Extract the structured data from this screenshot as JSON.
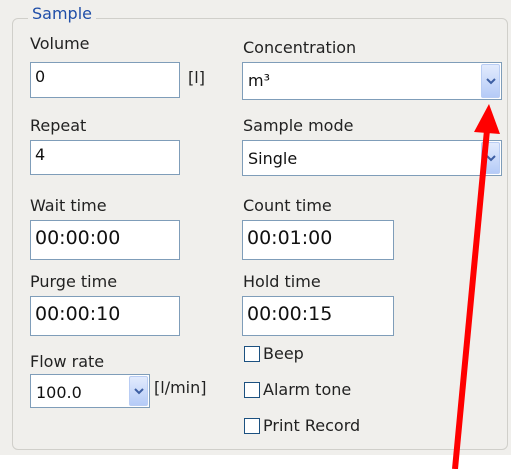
{
  "group": {
    "title": "Sample"
  },
  "volume": {
    "label": "Volume",
    "value": "0",
    "unit": "[l]"
  },
  "concentration": {
    "label": "Concentration",
    "selected": "m³"
  },
  "repeat": {
    "label": "Repeat",
    "value": "4"
  },
  "sample_mode": {
    "label": "Sample mode",
    "selected": "Single"
  },
  "wait_time": {
    "label": "Wait time",
    "value": "00:00:00"
  },
  "count_time": {
    "label": "Count time",
    "value": "00:01:00"
  },
  "purge_time": {
    "label": "Purge time",
    "value": "00:00:10"
  },
  "hold_time": {
    "label": "Hold time",
    "value": "00:00:15"
  },
  "flow_rate": {
    "label": "Flow rate",
    "selected": "100.0",
    "unit": "[l/min]"
  },
  "checkboxes": [
    {
      "label": "Beep",
      "checked": false
    },
    {
      "label": "Alarm tone",
      "checked": false
    },
    {
      "label": "Print Record",
      "checked": false
    }
  ],
  "icons": {
    "dropdown": "chevron-down-icon",
    "annotation": "red-arrow"
  },
  "colors": {
    "legend": "#1f4ea8",
    "arrow": "#ff0000",
    "field_border": "#7f9db9"
  }
}
